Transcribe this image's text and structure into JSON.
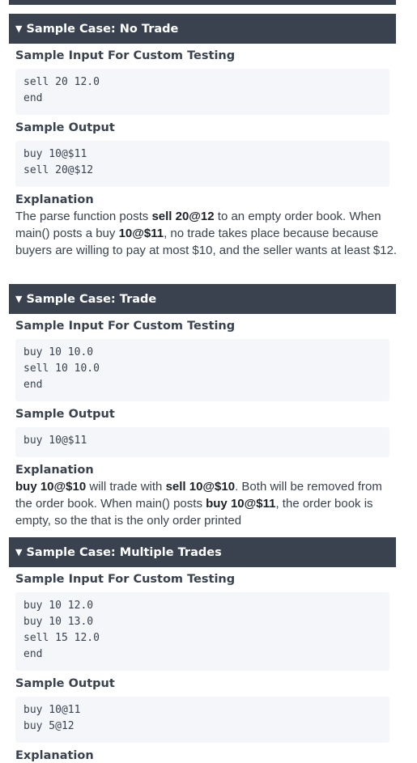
{
  "cases": [
    {
      "title": "Sample Case: No Trade",
      "input_label": "Sample Input For Custom Testing",
      "input_lines": [
        "sell 20 12.0",
        "end"
      ],
      "output_label": "Sample Output",
      "output_lines": [
        "buy 10@$11",
        "sell 20@$12"
      ],
      "explanation_label": "Explanation",
      "explanation": [
        {
          "t": "The parse function posts ",
          "b": false
        },
        {
          "t": "sell 20@12",
          "b": true
        },
        {
          "t": " to an empty order book. When main() posts a buy ",
          "b": false
        },
        {
          "t": "10@$11",
          "b": true
        },
        {
          "t": ", no trade takes place because because buyers are willing to pay at most $10, and the seller wants at least $12.",
          "b": false
        }
      ]
    },
    {
      "title": "Sample Case: Trade",
      "input_label": "Sample Input For Custom Testing",
      "input_lines": [
        "buy 10 10.0",
        "sell 10 10.0",
        "end"
      ],
      "output_label": "Sample Output",
      "output_lines": [
        "buy 10@$11"
      ],
      "explanation_label": "Explanation",
      "explanation": [
        {
          "t": "buy 10@$10",
          "b": true
        },
        {
          "t": " will trade with ",
          "b": false
        },
        {
          "t": "sell 10@$10",
          "b": true
        },
        {
          "t": ". Both will be removed from the order book. When main() posts ",
          "b": false
        },
        {
          "t": "buy 10@$11",
          "b": true
        },
        {
          "t": ", the order book is empty, so the that is the only order printed",
          "b": false
        }
      ]
    },
    {
      "title": "Sample Case: Multiple Trades",
      "input_label": "Sample Input For Custom Testing",
      "input_lines": [
        "buy 10 12.0",
        "buy 10 13.0",
        "sell 15 12.0",
        "end"
      ],
      "output_label": "Sample Output",
      "output_lines": [
        "buy 10@11",
        "buy 5@12"
      ],
      "explanation_label": "Explanation",
      "explanation": []
    }
  ],
  "caret_icon": "▼"
}
